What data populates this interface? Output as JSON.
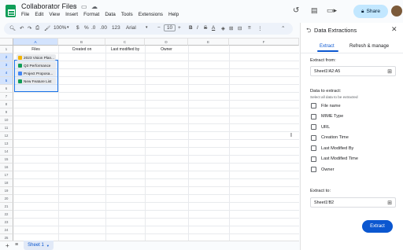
{
  "app": {
    "doc_title": "Collaborator Files",
    "menu": [
      "File",
      "Edit",
      "View",
      "Insert",
      "Format",
      "Data",
      "Tools",
      "Extensions",
      "Help"
    ],
    "share_label": "Share"
  },
  "toolbar": {
    "zoom": "100%",
    "currency": "$",
    "percent": "%",
    "dec_less": ".0",
    "dec_more": ".00",
    "number_format": "123",
    "font": "Arial",
    "font_size": "10",
    "bold": "B",
    "italic": "I",
    "text_color": "A"
  },
  "grid": {
    "columns": [
      "A",
      "B",
      "C",
      "D",
      "E",
      "F"
    ],
    "header_row": [
      "Files",
      "Created on",
      "Last modified by",
      "Owner",
      "",
      ""
    ],
    "rows": [
      "1",
      "2",
      "3",
      "4",
      "5",
      "6",
      "7",
      "8",
      "9",
      "10",
      "11",
      "12",
      "13",
      "14",
      "15",
      "16",
      "17",
      "18",
      "19",
      "20",
      "21",
      "22",
      "23",
      "24",
      "25"
    ],
    "chips": [
      {
        "label": "2023 Vision Plan...",
        "color": "#f4b400"
      },
      {
        "label": "Q3 Performance",
        "color": "#0f9d58"
      },
      {
        "label": "Project Proposa...",
        "color": "#4285f4"
      },
      {
        "label": "New Feature List",
        "color": "#0f9d58"
      }
    ]
  },
  "sheet": {
    "tab_label": "Sheet 1"
  },
  "panel": {
    "title": "Data Extractions",
    "tabs": [
      "Extract",
      "Refresh & manage"
    ],
    "extract_from_label": "Extract from:",
    "extract_from_value": "Sheet1!A2:A5",
    "data_to_extract_label": "Data to extract:",
    "data_to_extract_hint": "Select all data to be extracted",
    "options": [
      "File name",
      "MIME Type",
      "URL",
      "Creation Time",
      "Last Modified By",
      "Last Modified Time",
      "Owner"
    ],
    "extract_to_label": "Extract to:",
    "extract_to_value": "Sheet1!B2",
    "extract_button": "Extract"
  }
}
